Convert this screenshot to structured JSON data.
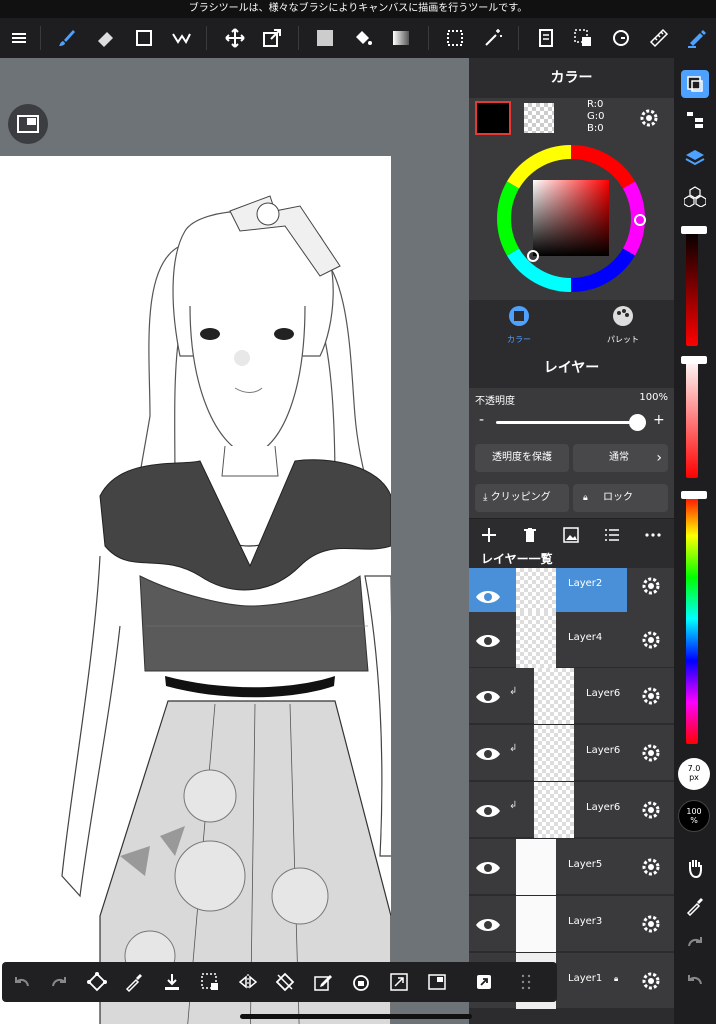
{
  "hint_bar": {
    "text": "ブラシツールは、様々なブラシによりキャンバスに描画を行うツールです。"
  },
  "top_toolbar": {
    "tools": [
      "menu-icon",
      "brush-icon",
      "eraser-icon",
      "rectangle-icon",
      "fill-icon",
      "move-icon",
      "transform-icon",
      "fill-color-icon",
      "bucket-icon",
      "gradient-icon",
      "selection-icon",
      "magic-wand-icon",
      "layer-panel-icon",
      "select-layer-icon",
      "rotate-icon",
      "ruler-icon",
      "pen-icon"
    ],
    "accent": "#4ea1ff"
  },
  "color_panel": {
    "title": "カラー",
    "rgb": {
      "r": "R:0",
      "g": "G:0",
      "b": "B:0"
    },
    "main_color": "#000000",
    "tabs": [
      {
        "label": "カラー",
        "active": true
      },
      {
        "label": "パレット",
        "active": false
      }
    ]
  },
  "layer_panel": {
    "title": "レイヤー",
    "opacity_label": "不透明度",
    "opacity_value": "100%",
    "opacity_minus": "-",
    "opacity_plus": "+",
    "protect_alpha": "透明度を保護",
    "blend_mode": "通常",
    "clipping": "クリッピング",
    "lock": "ロック",
    "list_title": "レイヤー一覧",
    "layers": [
      {
        "name": "Layer2",
        "selected": true,
        "clipped": false,
        "locked": false
      },
      {
        "name": "Layer4",
        "selected": false,
        "clipped": false,
        "locked": false
      },
      {
        "name": "Layer6",
        "selected": false,
        "clipped": true,
        "locked": false
      },
      {
        "name": "Layer6",
        "selected": false,
        "clipped": true,
        "locked": false
      },
      {
        "name": "Layer6",
        "selected": false,
        "clipped": true,
        "locked": false
      },
      {
        "name": "Layer5",
        "selected": false,
        "clipped": false,
        "locked": false
      },
      {
        "name": "Layer3",
        "selected": false,
        "clipped": false,
        "locked": false
      },
      {
        "name": "Layer1",
        "selected": false,
        "clipped": false,
        "locked": true
      }
    ]
  },
  "right_bar": {
    "brush_size_value": "7.0",
    "brush_size_unit": "px",
    "brush_opacity_value": "100",
    "brush_opacity_unit": "%"
  },
  "bottom_toolbar": {
    "tools": [
      "undo-icon",
      "redo-icon",
      "transform-icon",
      "eyedropper-icon",
      "save-icon",
      "selection-icon",
      "flip-icon",
      "rotate-reset-icon",
      "edit-icon",
      "rotate-icon",
      "fullscreen-icon",
      "navigator-icon",
      "share-icon",
      "grid-icon"
    ]
  }
}
